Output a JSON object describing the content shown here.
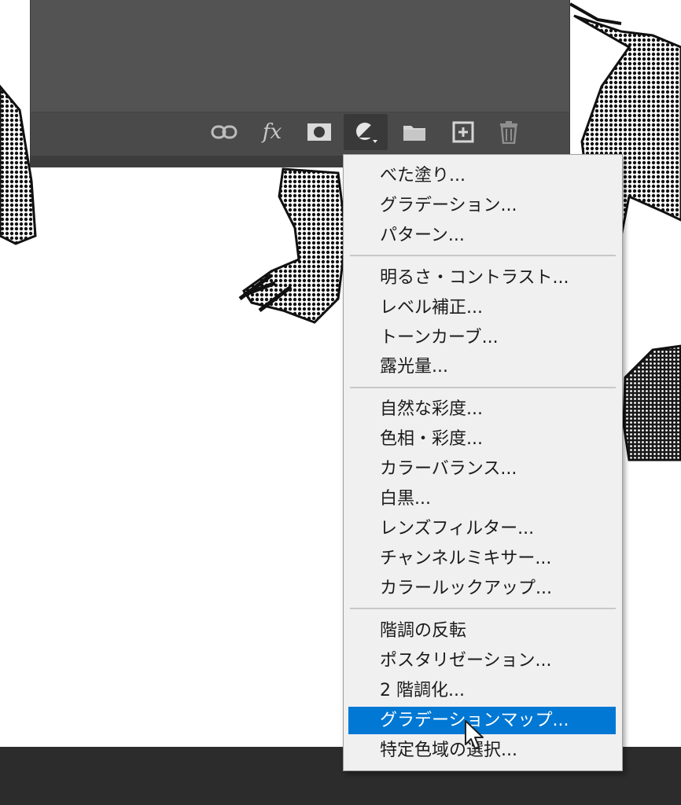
{
  "canvas": {
    "background": "#ffffff"
  },
  "layers_panel": {
    "footer_tools": [
      {
        "name": "link-layers-icon"
      },
      {
        "name": "fx-icon",
        "label": "fx"
      },
      {
        "name": "add-mask-icon"
      },
      {
        "name": "adjustment-layer-icon"
      },
      {
        "name": "group-folder-icon"
      },
      {
        "name": "new-layer-icon"
      },
      {
        "name": "trash-icon"
      }
    ]
  },
  "menu": {
    "highlight_color": "#0078d4",
    "groups": [
      [
        "べた塗り...",
        "グラデーション...",
        "パターン..."
      ],
      [
        "明るさ・コントラスト...",
        "レベル補正...",
        "トーンカーブ...",
        "露光量..."
      ],
      [
        "自然な彩度...",
        "色相・彩度...",
        "カラーバランス...",
        "白黒...",
        "レンズフィルター...",
        "チャンネルミキサー...",
        "カラールックアップ..."
      ],
      [
        "階調の反転",
        "ポスタリゼーション...",
        "2 階調化...",
        "グラデーションマップ...",
        "特定色域の選択..."
      ]
    ],
    "highlighted_item": "グラデーションマップ..."
  }
}
